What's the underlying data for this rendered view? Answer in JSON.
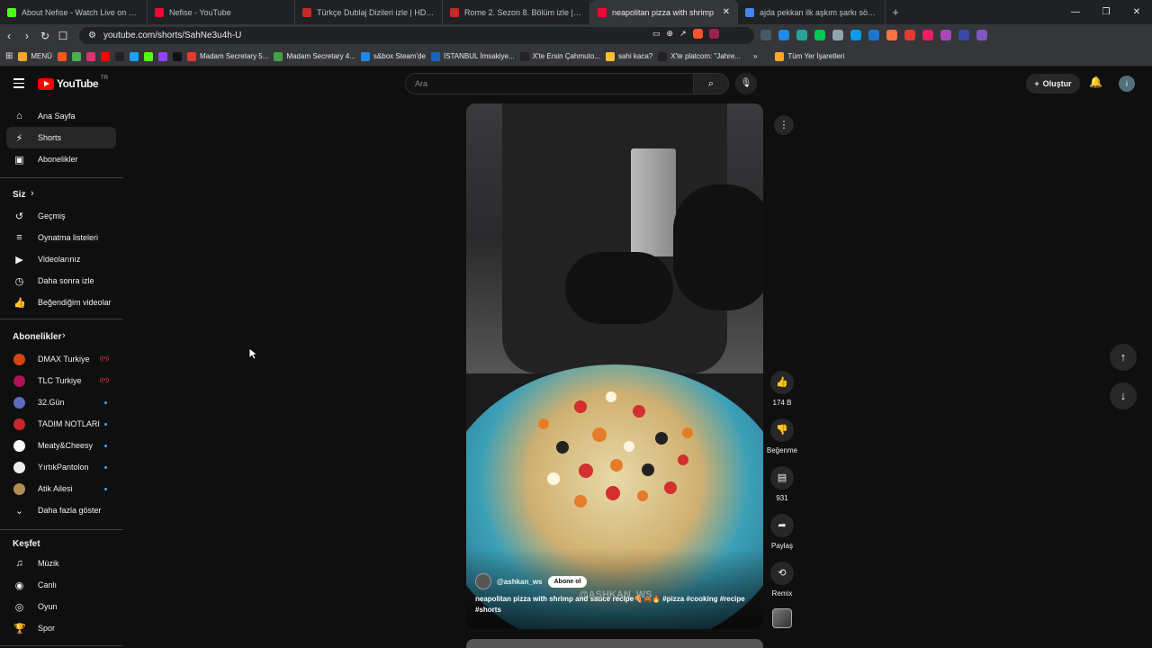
{
  "browser": {
    "tabs": [
      {
        "title": "About Nefise - Watch Live on Kick",
        "color": "#53fc18"
      },
      {
        "title": "Nefise - YouTube",
        "color": "#ff0033"
      },
      {
        "title": "Türkçe Dublaj Dizileri izle | HDFilmcel",
        "color": "#c62828"
      },
      {
        "title": "Rome 2. Sezon 8. Bölüm izle | HDFilm",
        "color": "#c62828"
      },
      {
        "title": "neapolitan pizza with shrimp",
        "color": "#ff0033",
        "active": true
      },
      {
        "title": "ajda pekkan ilk aşkım şarkı sözleri - G",
        "color": "#4285f4"
      }
    ],
    "new_tab": "+",
    "url": "youtube.com/shorts/SahNe3u4h-U",
    "bookmarks": [
      {
        "label": "MENÜ",
        "color": "#f9a825"
      },
      {
        "label": "",
        "color": "#ff5722"
      },
      {
        "label": "",
        "color": "#4caf50"
      },
      {
        "label": "",
        "color": "#e1306c"
      },
      {
        "label": "",
        "color": "#ff0000"
      },
      {
        "label": "",
        "color": "#222"
      },
      {
        "label": "",
        "color": "#1da1f2"
      },
      {
        "label": "",
        "color": "#53fc18"
      },
      {
        "label": "",
        "color": "#9146ff"
      },
      {
        "label": "",
        "color": "#111"
      },
      {
        "label": "Madam Secretary 5...",
        "color": "#e53935"
      },
      {
        "label": "Madam Secretary 4...",
        "color": "#43a047"
      },
      {
        "label": "s&box Steam'de",
        "color": "#1e88e5"
      },
      {
        "label": "İSTANBUL İmsakiye...",
        "color": "#1565c0"
      },
      {
        "label": "X'te Ersin Çahmuto...",
        "color": "#222"
      },
      {
        "label": "sahi kaca?",
        "color": "#fbc02d"
      },
      {
        "label": "X'te platcom: \"Jahre...",
        "color": "#222"
      }
    ],
    "all_bookmarks": "Tüm Yer İşaretleri"
  },
  "youtube": {
    "logo": "YouTube",
    "country": "TR",
    "search_placeholder": "Ara",
    "create_label": "Oluştur",
    "account_initial": "i",
    "nav": [
      {
        "label": "Ana Sayfa",
        "icon": "home-icon",
        "glyph": "⌂"
      },
      {
        "label": "Shorts",
        "icon": "shorts-icon",
        "glyph": "⚡",
        "active": true
      },
      {
        "label": "Abonelikler",
        "icon": "subscriptions-icon",
        "glyph": "▣"
      }
    ],
    "you_heading": "Siz",
    "you_items": [
      {
        "label": "Geçmiş",
        "icon": "history-icon",
        "glyph": "↺"
      },
      {
        "label": "Oynatma listeleri",
        "icon": "playlists-icon",
        "glyph": "≡"
      },
      {
        "label": "Videolarınız",
        "icon": "your-videos-icon",
        "glyph": "▶"
      },
      {
        "label": "Daha sonra izle",
        "icon": "watch-later-icon",
        "glyph": "◷"
      },
      {
        "label": "Beğendiğim videolar",
        "icon": "liked-icon",
        "glyph": "👍"
      }
    ],
    "subs_heading": "Abonelikler",
    "subs": [
      {
        "label": "DMAX Turkiye",
        "color": "#d84315",
        "status": "live"
      },
      {
        "label": "TLC Turkiye",
        "color": "#ad1457",
        "status": "live"
      },
      {
        "label": "32.Gün",
        "color": "#5c6bc0",
        "status": "dot"
      },
      {
        "label": "TADIM NOTLARI",
        "color": "#c62828",
        "status": "dot"
      },
      {
        "label": "Meaty&Cheesy",
        "color": "#fafafa",
        "status": "dot"
      },
      {
        "label": "YırtıkPantolon",
        "color": "#eeeeee",
        "status": "dot"
      },
      {
        "label": "Atik Ailesi",
        "color": "#b08d57",
        "status": "dot"
      }
    ],
    "show_more": "Daha fazla göster",
    "explore_heading": "Keşfet",
    "explore": [
      {
        "label": "Müzik",
        "icon": "music-icon",
        "glyph": "♫"
      },
      {
        "label": "Canlı",
        "icon": "live-icon",
        "glyph": "◉"
      },
      {
        "label": "Oyun",
        "icon": "gaming-icon",
        "glyph": "◎"
      },
      {
        "label": "Spor",
        "icon": "sports-icon",
        "glyph": "🏆"
      }
    ],
    "live_glyph": "((•))",
    "short": {
      "channel": "@ashkan_ws",
      "subscribe": "Abone ol",
      "watermark": "@ASHKAN_WS",
      "caption": "neapolitan pizza with shrimp and sauce recipe🍕🦐🔥 #pizza #cooking #recipe #shorts",
      "likes": "174 B",
      "dislike": "Beğenme",
      "comments": "931",
      "share": "Paylaş",
      "remix": "Remix"
    }
  }
}
